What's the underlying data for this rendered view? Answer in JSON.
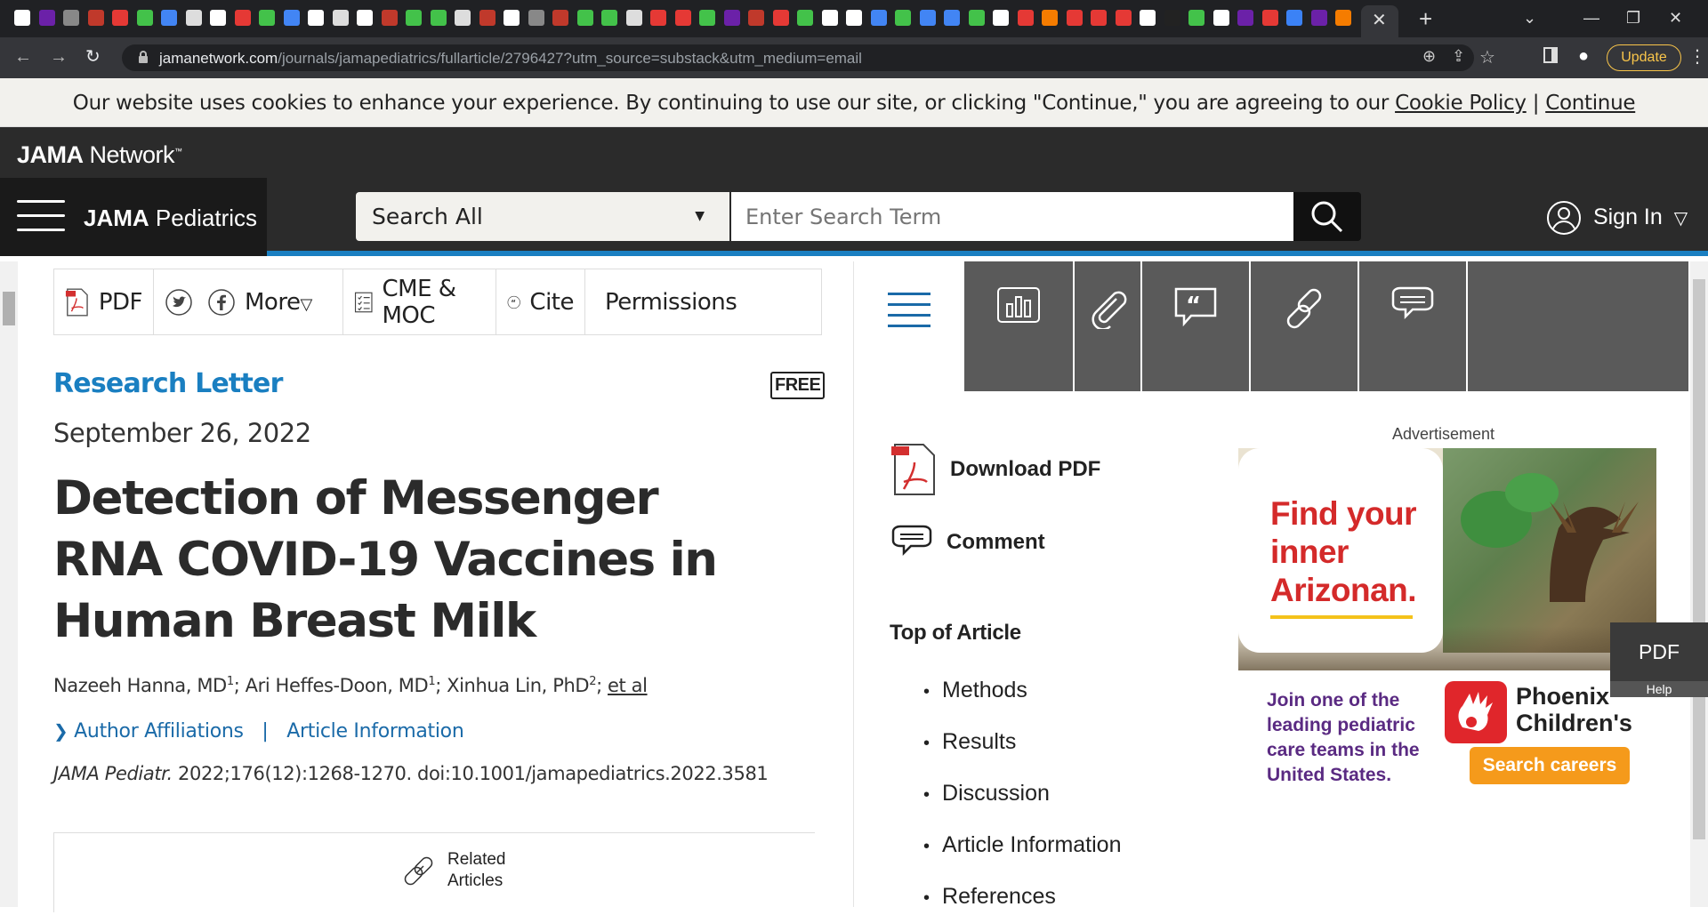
{
  "browser": {
    "tab_icon_colors": [
      "#fff",
      "#6b21a8",
      "#888",
      "#c0392b",
      "#e53935",
      "#43c24a",
      "#4285f4",
      "#ddd",
      "#fff",
      "#e53935",
      "#43c24a",
      "#4285f4",
      "#fff",
      "#ddd",
      "#fff",
      "#c0392b",
      "#43c24a",
      "#43c24a",
      "#ddd",
      "#c0392b",
      "#fff",
      "#888",
      "#c0392b",
      "#43c24a",
      "#43c24a",
      "#ddd",
      "#e53935",
      "#e53935",
      "#43c24a",
      "#6b21a8",
      "#c0392b",
      "#e53935",
      "#43c24a",
      "#fff",
      "#fff",
      "#4285f4",
      "#43c24a",
      "#4285f4",
      "#4285f4",
      "#43c24a",
      "#fff",
      "#e53935",
      "#f57c00",
      "#e53935",
      "#e53935",
      "#e53935",
      "#fff",
      "#222",
      "#43c24a",
      "#fff",
      "#6b21a8",
      "#e53935",
      "#3b82f6",
      "#6b21a8",
      "#f57c00"
    ],
    "new_tab_label": "+",
    "address": {
      "lock_icon": "lock-icon",
      "url_domain": "jamanetwork.com",
      "url_path": "/journals/jamapediatrics/fullarticle/2796427?utm_source=substack&utm_medium=email"
    },
    "update_label": "Update"
  },
  "cookie": {
    "text": "Our website uses cookies to enhance your experience. By continuing to use our site, or clicking \"Continue,\" you are agreeing to our",
    "policy_link": "Cookie Policy",
    "separator": "|",
    "continue_link": "Continue"
  },
  "network": {
    "logo_bold": "JAMA",
    "logo_rest": " Network",
    "logo_tm": "™"
  },
  "journal": {
    "name_bold": "JAMA",
    "name_rest": " Pediatrics",
    "search_scope": "Search All",
    "search_placeholder": "Enter Search Term",
    "signin_label": "Sign In"
  },
  "tools": {
    "pdf": "PDF",
    "more": "More",
    "cme": "CME & MOC",
    "cite": "Cite",
    "permissions": "Permissions"
  },
  "article": {
    "type": "Research Letter",
    "free_badge": "FREE",
    "date": "September 26, 2022",
    "title": "Detection of Messenger RNA COVID-19 Vaccines in Human Breast Milk",
    "authors": [
      {
        "name": "Nazeeh Hanna, MD",
        "sup": "1"
      },
      {
        "name": "Ari Heffes-Doon, MD",
        "sup": "1"
      },
      {
        "name": "Xinhua Lin, PhD",
        "sup": "2"
      }
    ],
    "author_sep": "; ",
    "etal": "et al",
    "affiliations_link": "Author Affiliations",
    "affil_sep": "|",
    "article_info_link": "Article Information",
    "citation_journal": "JAMA Pediatr.",
    "citation_rest": " 2022;176(12):1268-1270. doi:10.1001/jamapediatrics.2022.3581",
    "related_label": "Related Articles"
  },
  "sidebar": {
    "download_pdf": "Download PDF",
    "comment": "Comment",
    "top_of_article": "Top of Article",
    "toc": [
      "Methods",
      "Results",
      "Discussion",
      "Article Information",
      "References"
    ]
  },
  "ad": {
    "label": "Advertisement",
    "headline": "Find your inner Arizonan.",
    "sub": "Join one of the leading pediatric care teams in the United States.",
    "brand": "Phoenix Children's",
    "cta": "Search careers"
  },
  "floating_pdf": {
    "label": "PDF",
    "help": "Help"
  }
}
